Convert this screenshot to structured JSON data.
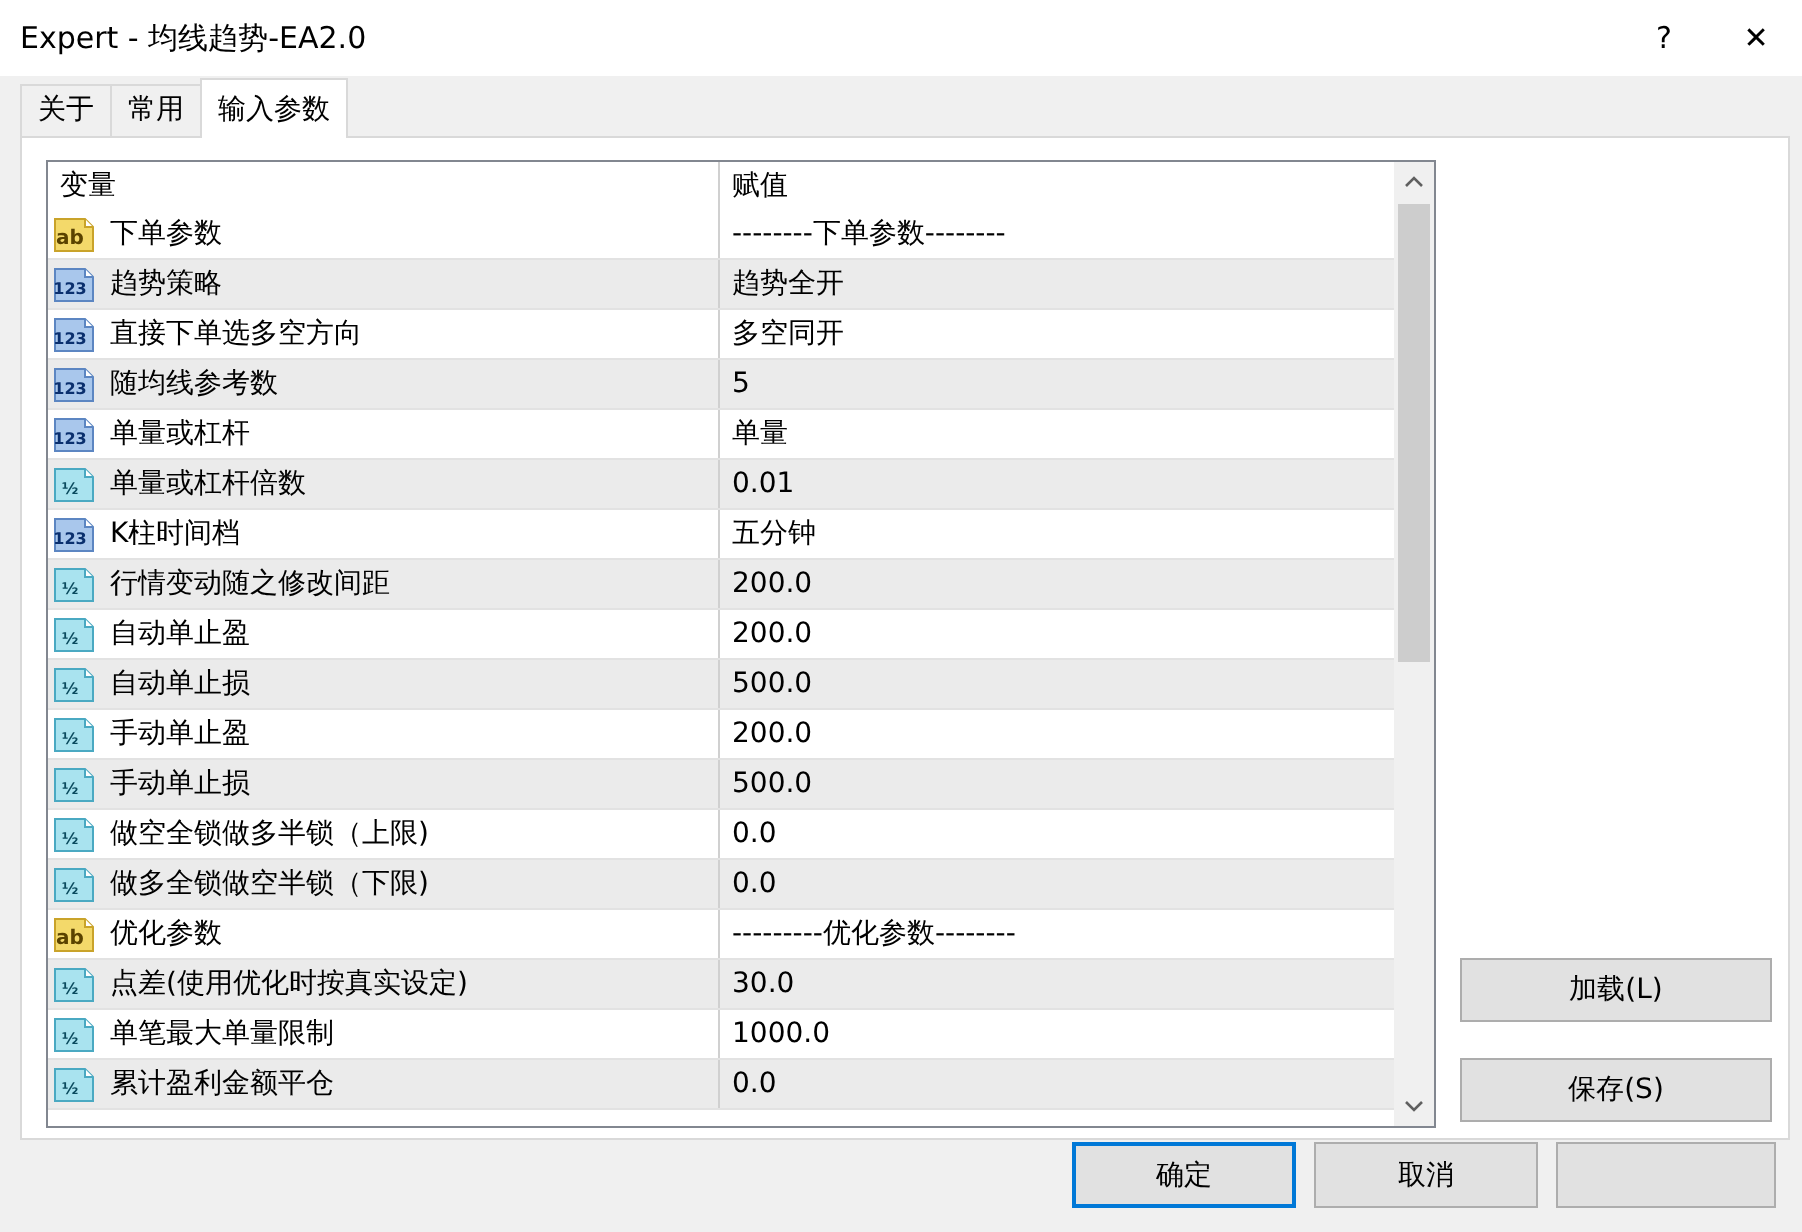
{
  "window": {
    "title": "Expert - 均线趋势-EA2.0",
    "help": "?",
    "close": "✕"
  },
  "tabs": [
    {
      "label": "关于",
      "selected": false
    },
    {
      "label": "常用",
      "selected": false
    },
    {
      "label": "输入参数",
      "selected": true
    }
  ],
  "table": {
    "columns": [
      "变量",
      "赋值"
    ],
    "rows": [
      {
        "kind": "string",
        "badge": "ab",
        "name": "下单参数",
        "value": "--------下单参数--------"
      },
      {
        "kind": "int",
        "badge": "123",
        "name": "趋势策略",
        "value": "趋势全开"
      },
      {
        "kind": "int",
        "badge": "123",
        "name": "直接下单选多空方向",
        "value": "多空同开"
      },
      {
        "kind": "int",
        "badge": "123",
        "name": "随均线参考数",
        "value": "5"
      },
      {
        "kind": "int",
        "badge": "123",
        "name": "单量或杠杆",
        "value": "单量"
      },
      {
        "kind": "double",
        "badge": "½",
        "name": "单量或杠杆倍数",
        "value": "0.01"
      },
      {
        "kind": "int",
        "badge": "123",
        "name": "K柱时间档",
        "value": "五分钟"
      },
      {
        "kind": "double",
        "badge": "½",
        "name": "行情变动随之修改间距",
        "value": "200.0"
      },
      {
        "kind": "double",
        "badge": "½",
        "name": "自动单止盈",
        "value": "200.0"
      },
      {
        "kind": "double",
        "badge": "½",
        "name": "自动单止损",
        "value": "500.0"
      },
      {
        "kind": "double",
        "badge": "½",
        "name": "手动单止盈",
        "value": "200.0"
      },
      {
        "kind": "double",
        "badge": "½",
        "name": "手动单止损",
        "value": "500.0"
      },
      {
        "kind": "double",
        "badge": "½",
        "name": "做空全锁做多半锁（上限)",
        "value": "0.0"
      },
      {
        "kind": "double",
        "badge": "½",
        "name": "做多全锁做空半锁（下限)",
        "value": "0.0"
      },
      {
        "kind": "string",
        "badge": "ab",
        "name": "优化参数",
        "value": "---------优化参数--------"
      },
      {
        "kind": "double",
        "badge": "½",
        "name": "点差(使用优化时按真实设定)",
        "value": "30.0"
      },
      {
        "kind": "double",
        "badge": "½",
        "name": "单笔最大单量限制",
        "value": "1000.0"
      },
      {
        "kind": "double",
        "badge": "½",
        "name": "累计盈利金额平仓",
        "value": "0.0"
      }
    ]
  },
  "side_buttons": [
    "加载(L)",
    "保存(S)"
  ],
  "footer_buttons": [
    "确定",
    "取消"
  ]
}
